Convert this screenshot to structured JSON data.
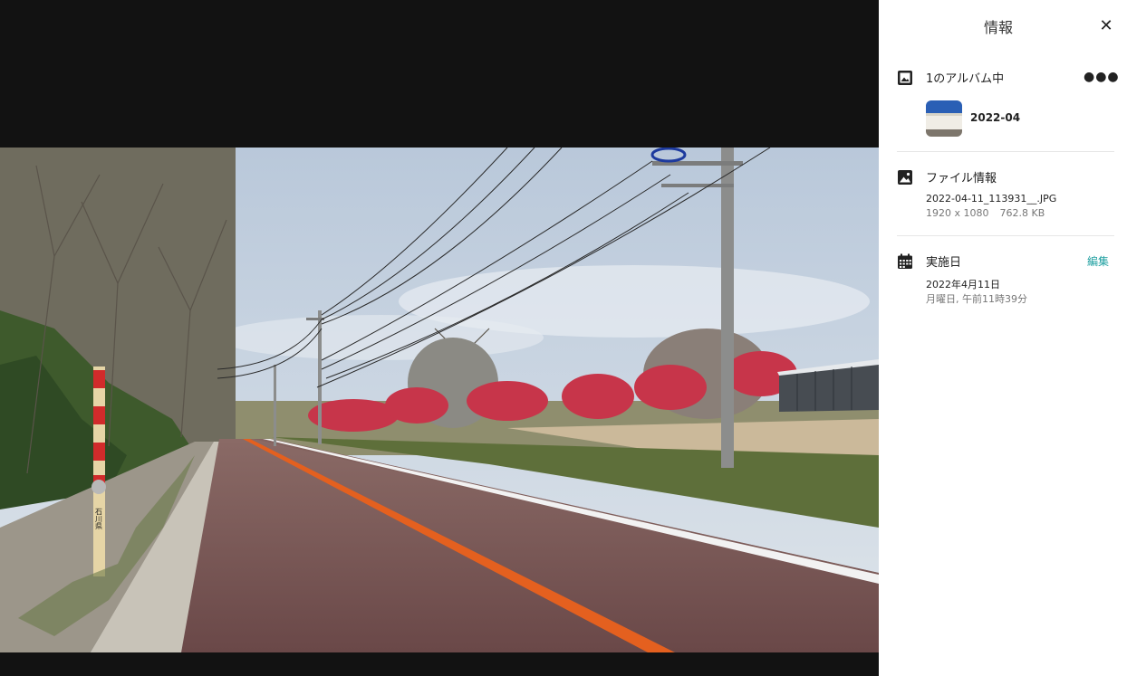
{
  "panel": {
    "title": "情報",
    "close_icon": "close-icon",
    "albums": {
      "heading": "1のアルバム中",
      "count": "1",
      "more_icon": "more-dots-icon",
      "album_name": "2022-04"
    },
    "file_info": {
      "heading": "ファイル情報",
      "filename": "2022-04-11_113931__.JPG",
      "dimensions": "1920 x 1080",
      "size": "762.8 KB"
    },
    "date": {
      "heading": "実施日",
      "edit_label": "編集",
      "date_line": "2022年4月11日",
      "time_line": "月曜日, 午前11時39分"
    }
  },
  "photo": {
    "pole_label": "石川県"
  },
  "colors": {
    "viewer_bg": "#121212",
    "panel_bg": "#ffffff",
    "accent": "#1e9fa0"
  }
}
